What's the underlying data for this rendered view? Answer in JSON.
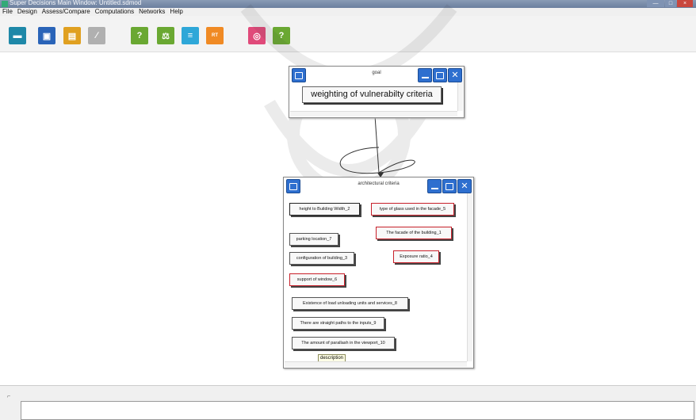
{
  "window": {
    "title": "Super Decisions Main Window: Untitled.sdmod",
    "minimize": "—",
    "maximize": "□",
    "close": "×"
  },
  "menu": {
    "items": [
      "File",
      "Design",
      "Assess/Compare",
      "Computations",
      "Networks",
      "Help"
    ]
  },
  "toolbar": {
    "buttons": [
      {
        "icon": "folder-open-icon",
        "glyph": "▬",
        "color": "#1e88a8"
      },
      {
        "icon": "save-icon",
        "glyph": "▣",
        "color": "#2a64b8"
      },
      {
        "icon": "print-icon",
        "glyph": "▤",
        "color": "#e0a020"
      },
      {
        "icon": "pencil-icon",
        "glyph": "∕",
        "color": "#b0b0b0"
      },
      {
        "icon": "question-mark-icon",
        "glyph": "?",
        "color": "#6aa832"
      },
      {
        "icon": "balance-icon",
        "glyph": "⚖",
        "color": "#6aa832"
      },
      {
        "icon": "sliders-icon",
        "glyph": "≡",
        "color": "#2ea7d8"
      },
      {
        "icon": "ratings-icon",
        "glyph": "RT",
        "color": "#f08a24"
      },
      {
        "icon": "headphones-icon",
        "glyph": "◎",
        "color": "#e04a7a"
      },
      {
        "icon": "help-icon",
        "glyph": "?",
        "color": "#6aa832"
      }
    ]
  },
  "goal_cluster": {
    "title": "goal",
    "element": "weighting of vulnerabilty criteria"
  },
  "criteria_cluster": {
    "title": "architectural criteria",
    "elements": [
      {
        "label": "height  to Building Width_2",
        "style": "dark"
      },
      {
        "label": "type of glass used in the facade_5",
        "style": "red"
      },
      {
        "label": "The facade of the building_1",
        "style": "red"
      },
      {
        "label": "parking location_7",
        "style": "plain"
      },
      {
        "label": "configuration of building_3",
        "style": "plain"
      },
      {
        "label": "Exposure ratio_4",
        "style": "red"
      },
      {
        "label": "support of window_6",
        "style": "red"
      },
      {
        "label": "Existence of load unloading units and services_8",
        "style": "plain"
      },
      {
        "label": "There are straight paths to the inputs_9",
        "style": "plain"
      },
      {
        "label": "The amount of parallash in the viewport_10",
        "style": "plain"
      }
    ],
    "tooltip": "description"
  },
  "colors": {
    "node_button": "#2e6fcf",
    "red_border": "#c8202a"
  }
}
